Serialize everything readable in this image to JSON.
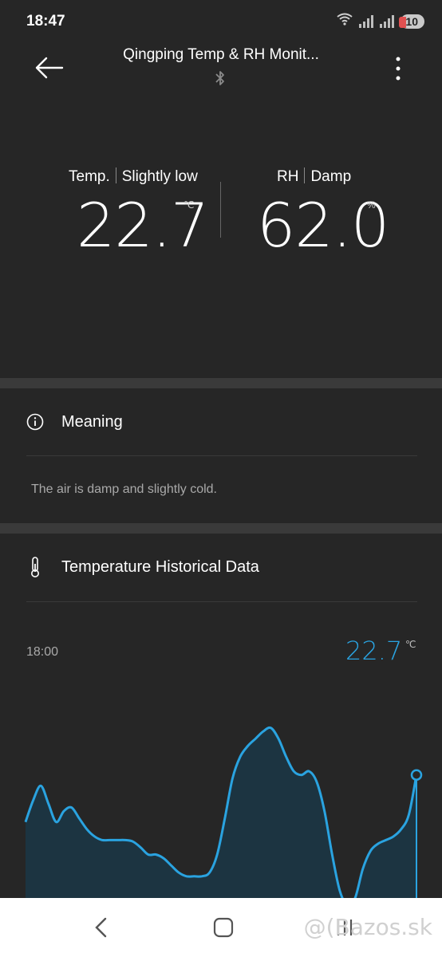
{
  "status_bar": {
    "time": "18:47",
    "battery": "10"
  },
  "header": {
    "title": "Qingping Temp & RH Monit..."
  },
  "readings": {
    "temp": {
      "label": "Temp.",
      "state": "Slightly low",
      "value": "22.7",
      "unit": "℃"
    },
    "rh": {
      "label": "RH",
      "state": "Damp",
      "value": "62.0",
      "unit": "%"
    }
  },
  "meaning": {
    "title": "Meaning",
    "text": "The air is damp and slightly cold."
  },
  "history": {
    "title": "Temperature Historical Data",
    "selected_time": "18:00",
    "selected_value": "22.7",
    "unit": "℃"
  },
  "chart_data": {
    "type": "area",
    "x": [
      0,
      1,
      2,
      3,
      4,
      5,
      6,
      7,
      8,
      9,
      10,
      11,
      12,
      13,
      14,
      15,
      16,
      17,
      18,
      19,
      20,
      21,
      22,
      23,
      24,
      25,
      26,
      27,
      28,
      29,
      30,
      31,
      32,
      33,
      34,
      35,
      36,
      37,
      38,
      39,
      40,
      41,
      42,
      43,
      44,
      45,
      46,
      47,
      48,
      49,
      50,
      51,
      52,
      53,
      54,
      55,
      56,
      57,
      58,
      59,
      60
    ],
    "values": [
      22.05,
      22.35,
      22.55,
      22.3,
      22.05,
      22.2,
      22.25,
      22.1,
      21.95,
      21.85,
      21.8,
      21.8,
      21.8,
      21.8,
      21.78,
      21.7,
      21.6,
      21.6,
      21.55,
      21.45,
      21.35,
      21.3,
      21.3,
      21.3,
      21.35,
      21.6,
      22.1,
      22.65,
      22.95,
      23.1,
      23.2,
      23.3,
      23.35,
      23.2,
      22.95,
      22.75,
      22.7,
      22.75,
      22.6,
      22.2,
      21.6,
      21.1,
      20.9,
      21.0,
      21.4,
      21.65,
      21.75,
      21.8,
      21.85,
      21.95,
      22.15,
      22.7
    ],
    "ylim": [
      21.0,
      23.6
    ],
    "color": "#2aa3e0",
    "fill": "#1c3441"
  },
  "watermark": "@(Bazos.sk"
}
